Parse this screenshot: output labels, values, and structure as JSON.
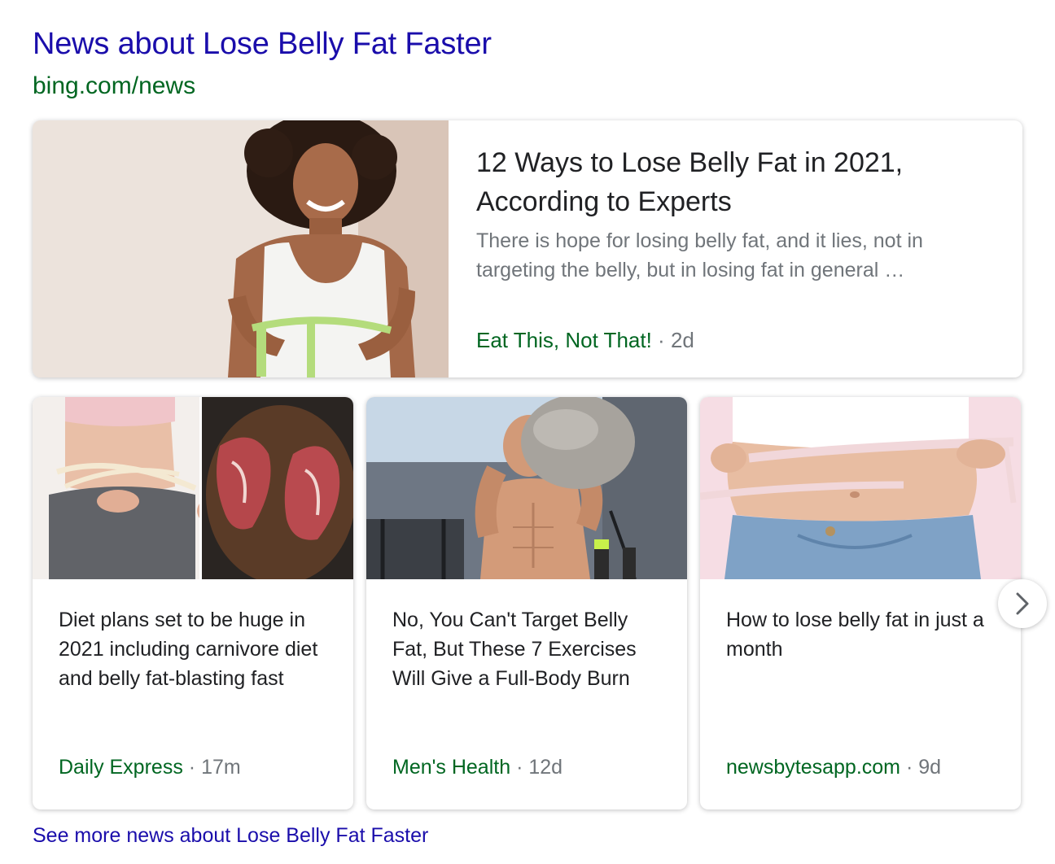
{
  "header": {
    "title": "News about Lose Belly Fat Faster",
    "url": "bing.com/news"
  },
  "featured": {
    "title": "12 Ways to Lose Belly Fat in 2021, According to Experts",
    "snippet": "There is hope for losing belly fat, and it lies, not in targeting the belly, but in losing fat in general …",
    "publisher": "Eat This, Not That!",
    "separator": "·",
    "age": "2d"
  },
  "cards": [
    {
      "title": "Diet plans set to be huge in 2021 including carnivore diet and belly fat-blasting fast",
      "publisher": "Daily Express",
      "separator": "·",
      "age": "17m"
    },
    {
      "title": "No, You Can't Target Belly Fat, But These 7 Exercises Will Give a Full-Body Burn",
      "publisher": "Men's Health",
      "separator": "·",
      "age": "12d"
    },
    {
      "title": "How to lose belly fat in just a month",
      "publisher": "newsbytesapp.com",
      "separator": "·",
      "age": "9d"
    }
  ],
  "next_icon": "chevron-right-icon",
  "footer": {
    "see_more": "See more news about Lose Belly Fat Faster"
  },
  "colors": {
    "link": "#1a0dab",
    "source": "#006621",
    "muted": "#70757a",
    "text": "#202124"
  }
}
